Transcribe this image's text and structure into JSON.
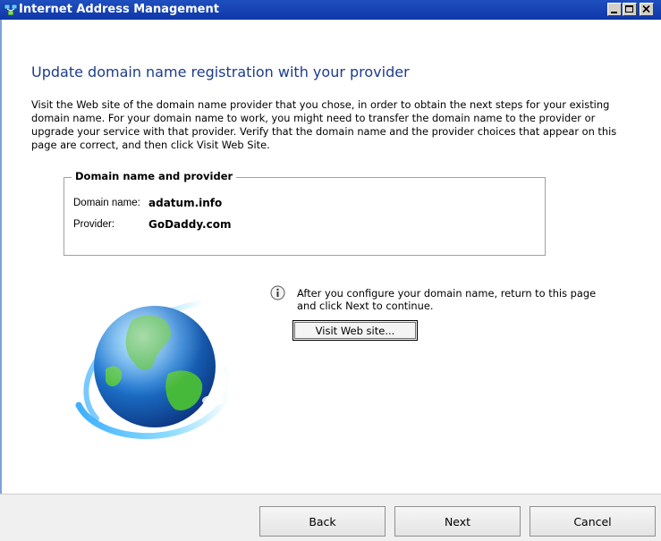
{
  "window": {
    "title": "Internet Address Management",
    "controls": [
      "minimize-icon",
      "maximize-icon",
      "close-icon"
    ]
  },
  "page": {
    "heading": "Update domain name registration with your provider",
    "description": "Visit the Web site of the domain name provider that you chose, in order to obtain the next steps for your existing domain name. For your domain name to work, you might need to transfer the domain name to the provider or upgrade your service with that provider. Verify that the domain name and the provider choices that appear on this page are correct, and then click Visit Web Site."
  },
  "group": {
    "label": "Domain name and provider",
    "fields": [
      {
        "label": "Domain name:",
        "value": "adatum.info"
      },
      {
        "label": "Provider:",
        "value": "GoDaddy.com"
      }
    ]
  },
  "info": {
    "icon": "info-icon",
    "text": "After you configure your domain name, return to this page and click Next to continue.",
    "visit_button": "Visit Web site..."
  },
  "footer": {
    "back": "Back",
    "next": "Next",
    "cancel": "Cancel"
  },
  "colors": {
    "titlebar": "#1f4fbf",
    "heading": "#1e3c8c",
    "footer_bg": "#f0f0f0"
  }
}
